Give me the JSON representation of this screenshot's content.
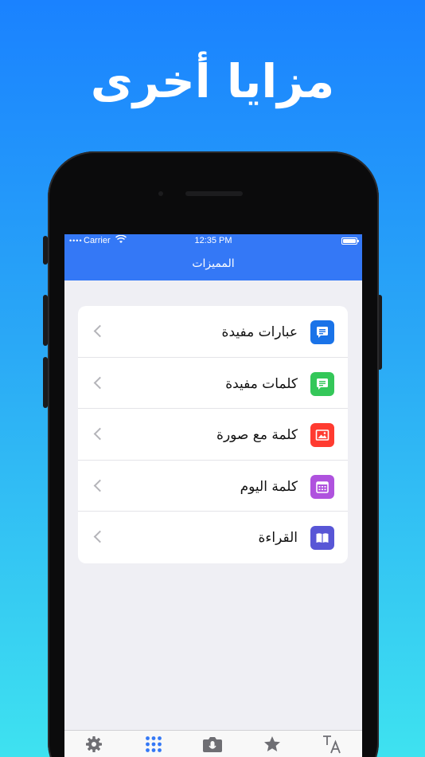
{
  "headline": "مزايا أخرى",
  "status_bar": {
    "carrier": "Carrier",
    "time": "12:35 PM"
  },
  "nav": {
    "title": "المميزات"
  },
  "features": [
    {
      "label": "عبارات مفيدة",
      "icon": "message-text-icon",
      "color": "#1a73e8"
    },
    {
      "label": "كلمات مفيدة",
      "icon": "message-text-icon",
      "color": "#34c759"
    },
    {
      "label": "كلمة مع صورة",
      "icon": "image-icon",
      "color": "#ff3b30"
    },
    {
      "label": "كلمة اليوم",
      "icon": "calendar-icon",
      "color": "#af52de"
    },
    {
      "label": "القراءة",
      "icon": "book-icon",
      "color": "#5856d6"
    }
  ],
  "tabs": [
    {
      "icon": "gear-icon",
      "active": false
    },
    {
      "icon": "grid-icon",
      "active": true
    },
    {
      "icon": "camera-icon",
      "active": false
    },
    {
      "icon": "star-icon",
      "active": false
    },
    {
      "icon": "translate-icon",
      "active": false
    }
  ],
  "colors": {
    "accent": "#3478f6",
    "tab_inactive": "#6e6e73"
  }
}
